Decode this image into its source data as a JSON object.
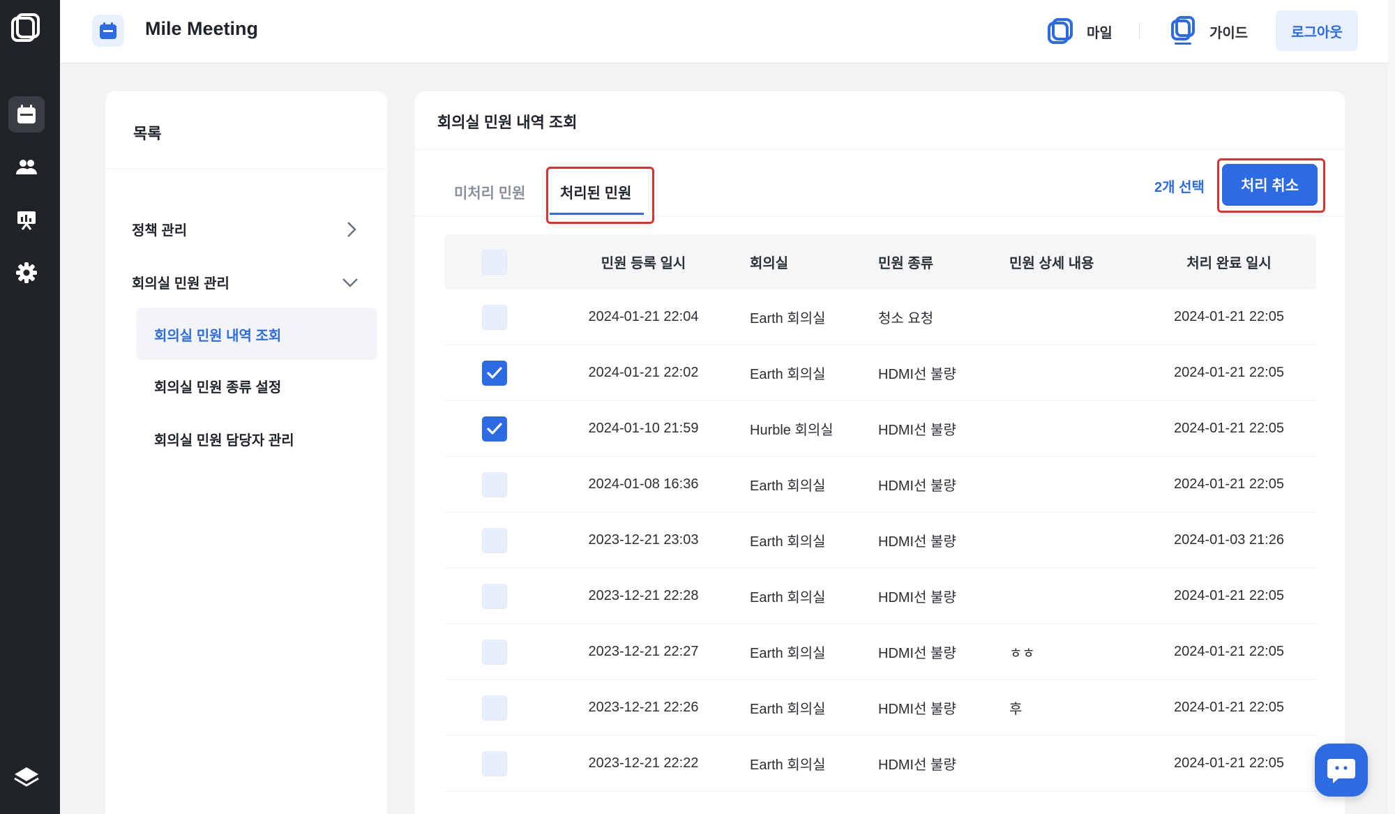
{
  "rail": {
    "items": [
      {
        "icon": "calendar-icon",
        "active": true
      },
      {
        "icon": "users-icon",
        "active": false
      },
      {
        "icon": "presentation-icon",
        "active": false
      },
      {
        "icon": "gear-icon",
        "active": false
      }
    ],
    "bottom_icon": "layers-icon"
  },
  "header": {
    "app_title": "Mile Meeting",
    "link_mile": "마일",
    "link_guide": "가이드",
    "logout": "로그아웃"
  },
  "sidebar": {
    "title": "목록",
    "menu_policy": "정책 관리",
    "menu_complaints": "회의실 민원 관리",
    "sub_items": [
      {
        "label": "회의실 민원 내역 조회",
        "active": true
      },
      {
        "label": "회의실 민원 종류 설정",
        "active": false
      },
      {
        "label": "회의실 민원 담당자 관리",
        "active": false
      }
    ]
  },
  "main": {
    "title": "회의실 민원 내역 조회",
    "tabs": [
      {
        "label": "미처리 민원",
        "active": false
      },
      {
        "label": "처리된 민원",
        "active": true
      }
    ],
    "selected_count": "2개 선택",
    "cancel_button": "처리 취소",
    "table": {
      "headers": [
        "민원 등록 일시",
        "회의실",
        "민원 종류",
        "민원 상세 내용",
        "처리 완료 일시"
      ],
      "rows": [
        {
          "checked": false,
          "registered": "2024-01-21 22:04",
          "room": "Earth 회의실",
          "type": "청소 요청",
          "detail": "",
          "completed": "2024-01-21 22:05"
        },
        {
          "checked": true,
          "registered": "2024-01-21 22:02",
          "room": "Earth 회의실",
          "type": "HDMI선 불량",
          "detail": "",
          "completed": "2024-01-21 22:05"
        },
        {
          "checked": true,
          "registered": "2024-01-10 21:59",
          "room": "Hurble 회의실",
          "type": "HDMI선 불량",
          "detail": "",
          "completed": "2024-01-21 22:05"
        },
        {
          "checked": false,
          "registered": "2024-01-08 16:36",
          "room": "Earth 회의실",
          "type": "HDMI선 불량",
          "detail": "",
          "completed": "2024-01-21 22:05"
        },
        {
          "checked": false,
          "registered": "2023-12-21 23:03",
          "room": "Earth 회의실",
          "type": "HDMI선 불량",
          "detail": "",
          "completed": "2024-01-03 21:26"
        },
        {
          "checked": false,
          "registered": "2023-12-21 22:28",
          "room": "Earth 회의실",
          "type": "HDMI선 불량",
          "detail": "",
          "completed": "2024-01-21 22:05"
        },
        {
          "checked": false,
          "registered": "2023-12-21 22:27",
          "room": "Earth 회의실",
          "type": "HDMI선 불량",
          "detail": "ㅎㅎ",
          "completed": "2024-01-21 22:05"
        },
        {
          "checked": false,
          "registered": "2023-12-21 22:26",
          "room": "Earth 회의실",
          "type": "HDMI선 불량",
          "detail": "후",
          "completed": "2024-01-21 22:05"
        },
        {
          "checked": false,
          "registered": "2023-12-21 22:22",
          "room": "Earth 회의실",
          "type": "HDMI선 불량",
          "detail": "",
          "completed": "2024-01-21 22:05"
        }
      ]
    }
  },
  "colors": {
    "accent": "#2d6be4",
    "highlight": "#e0312f",
    "rail_bg": "#202327"
  }
}
